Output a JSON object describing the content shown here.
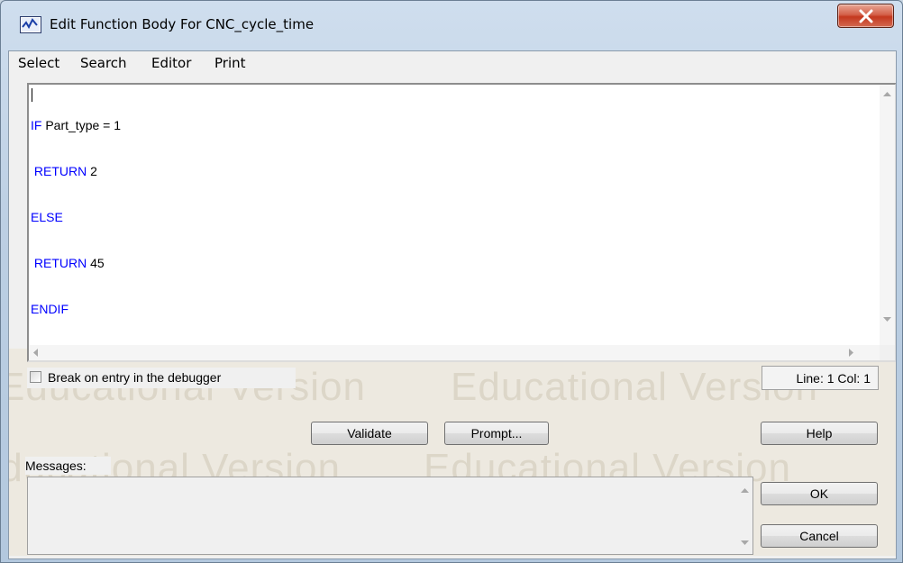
{
  "window": {
    "title": "Edit Function Body For CNC_cycle_time",
    "close_glyph": "close-icon"
  },
  "menu": [
    "Select",
    "Search",
    "Editor",
    "Print"
  ],
  "editor": {
    "lines": [
      {
        "kw": "IF",
        "rest": " Part_type = 1",
        "indent": ""
      },
      {
        "kw": "RETURN",
        "rest": " 2",
        "indent": " "
      },
      {
        "kw": "ELSE",
        "rest": "",
        "indent": ""
      },
      {
        "kw": "RETURN",
        "rest": " 45",
        "indent": " "
      },
      {
        "kw": "ENDIF",
        "rest": "",
        "indent": ""
      }
    ],
    "keyword_color": "#0000ff"
  },
  "debugger": {
    "label": "Break on entry in the debugger",
    "checked": false
  },
  "status": "Line: 1 Col: 1",
  "buttons": {
    "validate": "Validate",
    "prompt": "Prompt...",
    "help": "Help",
    "ok": "OK",
    "cancel": "Cancel"
  },
  "messages": {
    "label": "Messages:"
  },
  "watermark": "Educational Version"
}
